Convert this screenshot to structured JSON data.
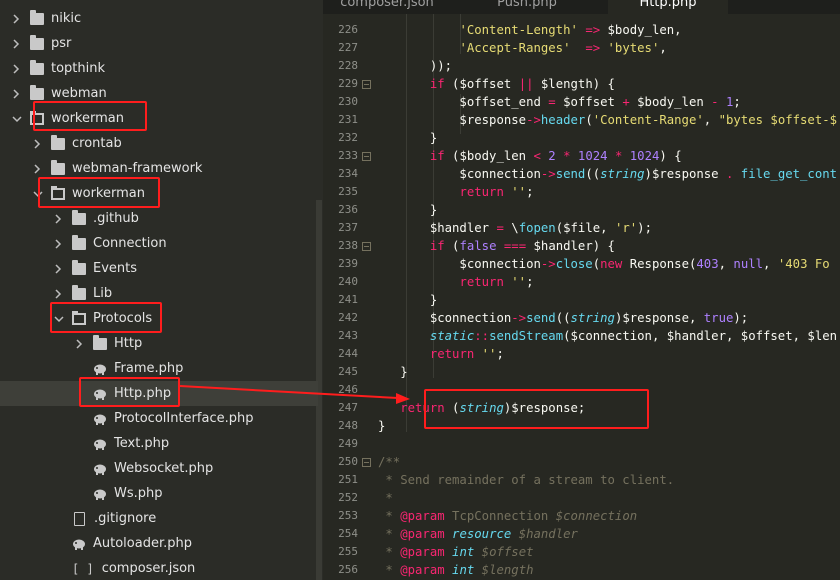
{
  "tabs": [
    {
      "label": "composer.json"
    },
    {
      "label": "Push.php"
    },
    {
      "label": "Http.php",
      "active": true
    }
  ],
  "tree": [
    {
      "label": "nikic",
      "type": "folder"
    },
    {
      "label": "psr",
      "type": "folder"
    },
    {
      "label": "topthink",
      "type": "folder"
    },
    {
      "label": "webman",
      "type": "folder"
    },
    {
      "label": "workerman",
      "type": "folder-open"
    },
    {
      "label": "crontab",
      "type": "folder"
    },
    {
      "label": "webman-framework",
      "type": "folder"
    },
    {
      "label": "workerman",
      "type": "folder-open"
    },
    {
      "label": ".github",
      "type": "folder"
    },
    {
      "label": "Connection",
      "type": "folder"
    },
    {
      "label": "Events",
      "type": "folder"
    },
    {
      "label": "Lib",
      "type": "folder"
    },
    {
      "label": "Protocols",
      "type": "folder-open"
    },
    {
      "label": "Http",
      "type": "folder"
    },
    {
      "label": "Frame.php",
      "type": "php"
    },
    {
      "label": "Http.php",
      "type": "php",
      "selected": true
    },
    {
      "label": "ProtocolInterface.php",
      "type": "php"
    },
    {
      "label": "Text.php",
      "type": "php"
    },
    {
      "label": "Websocket.php",
      "type": "php"
    },
    {
      "label": "Ws.php",
      "type": "php"
    },
    {
      "label": ".gitignore",
      "type": "file"
    },
    {
      "label": "Autoloader.php",
      "type": "php"
    },
    {
      "label": "composer.json",
      "type": "json",
      "icon": "[ ]"
    }
  ],
  "line_numbers": [
    "226",
    "227",
    "228",
    "229",
    "230",
    "231",
    "232",
    "233",
    "234",
    "235",
    "236",
    "237",
    "238",
    "239",
    "240",
    "241",
    "242",
    "243",
    "244",
    "245",
    "246",
    "247",
    "248",
    "249",
    "250",
    "251",
    "252",
    "253",
    "254",
    "255",
    "256"
  ],
  "colors": {
    "annotation": "#ff1d1d",
    "editor_bg": "#272822",
    "sidebar_bg": "#2b2c27"
  }
}
